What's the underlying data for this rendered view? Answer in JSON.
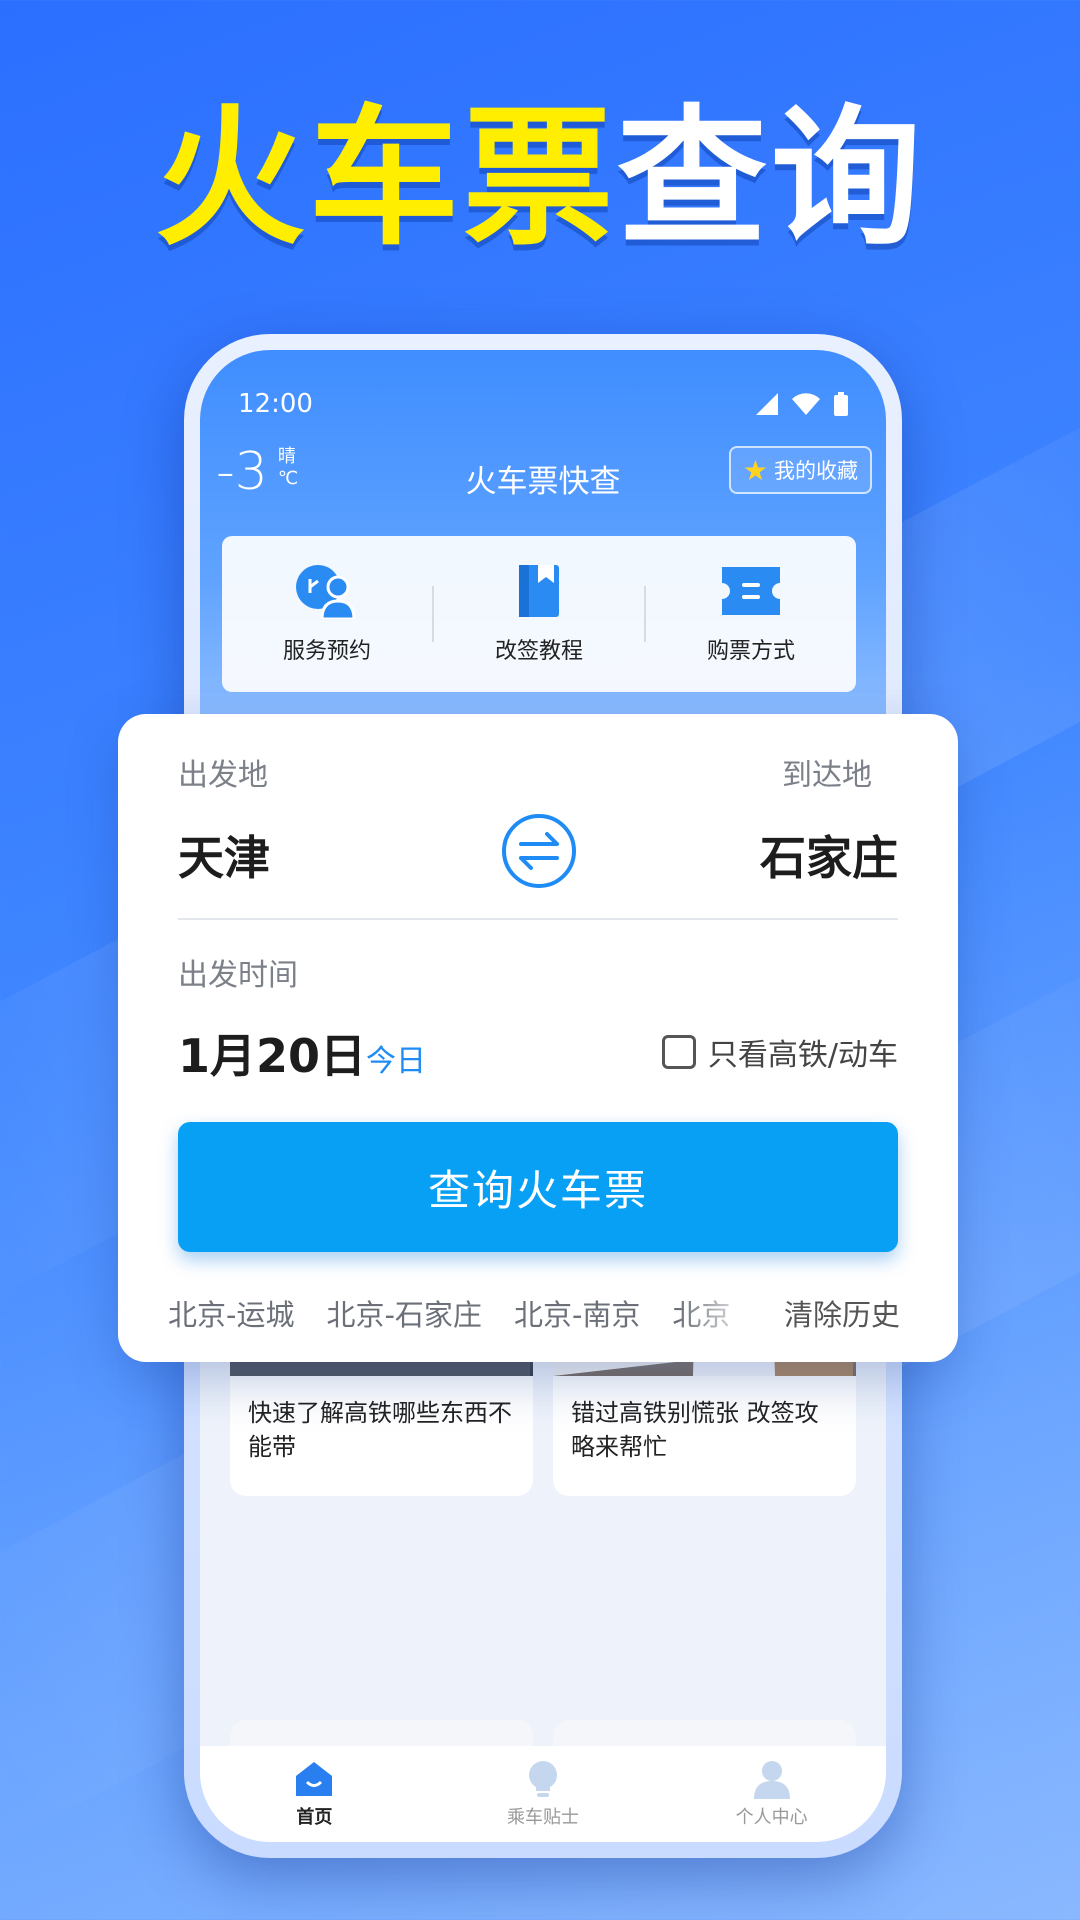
{
  "headline": {
    "part_yellow": "火车票",
    "part_white": "查询"
  },
  "status_bar": {
    "time": "12:00"
  },
  "header": {
    "temperature": "-3",
    "weather": "晴",
    "unit": "℃",
    "title": "火车票快查",
    "favorites_label": "我的收藏"
  },
  "quick_actions": [
    {
      "label": "服务预约",
      "icon": "service-booking-icon"
    },
    {
      "label": "改签教程",
      "icon": "bookmark-icon"
    },
    {
      "label": "购票方式",
      "icon": "ticket-icon"
    }
  ],
  "search": {
    "from_label": "出发地",
    "from_city": "天津",
    "to_label": "到达地",
    "to_city": "石家庄",
    "date_label": "出发时间",
    "date": "1月20日",
    "date_tag": "今日",
    "high_speed_only_label": "只看高铁/动车",
    "high_speed_only_checked": false,
    "submit_label": "查询火车票",
    "history": [
      "北京-运城",
      "北京-石家庄",
      "北京-南京",
      "北京"
    ],
    "clear_history_label": "清除历史"
  },
  "articles": [
    {
      "caption": "快速了解高铁哪些东西不能带"
    },
    {
      "caption": "错过高铁别慌张 改签攻略来帮忙"
    }
  ],
  "tabbar": [
    {
      "label": "首页",
      "icon": "home-icon",
      "active": true
    },
    {
      "label": "乘车贴士",
      "icon": "lightbulb-icon",
      "active": false
    },
    {
      "label": "个人中心",
      "icon": "user-icon",
      "active": false
    }
  ],
  "colors": {
    "accent": "#08a0f5",
    "headline_yellow": "#ffee00",
    "background": "#3f86ff"
  }
}
